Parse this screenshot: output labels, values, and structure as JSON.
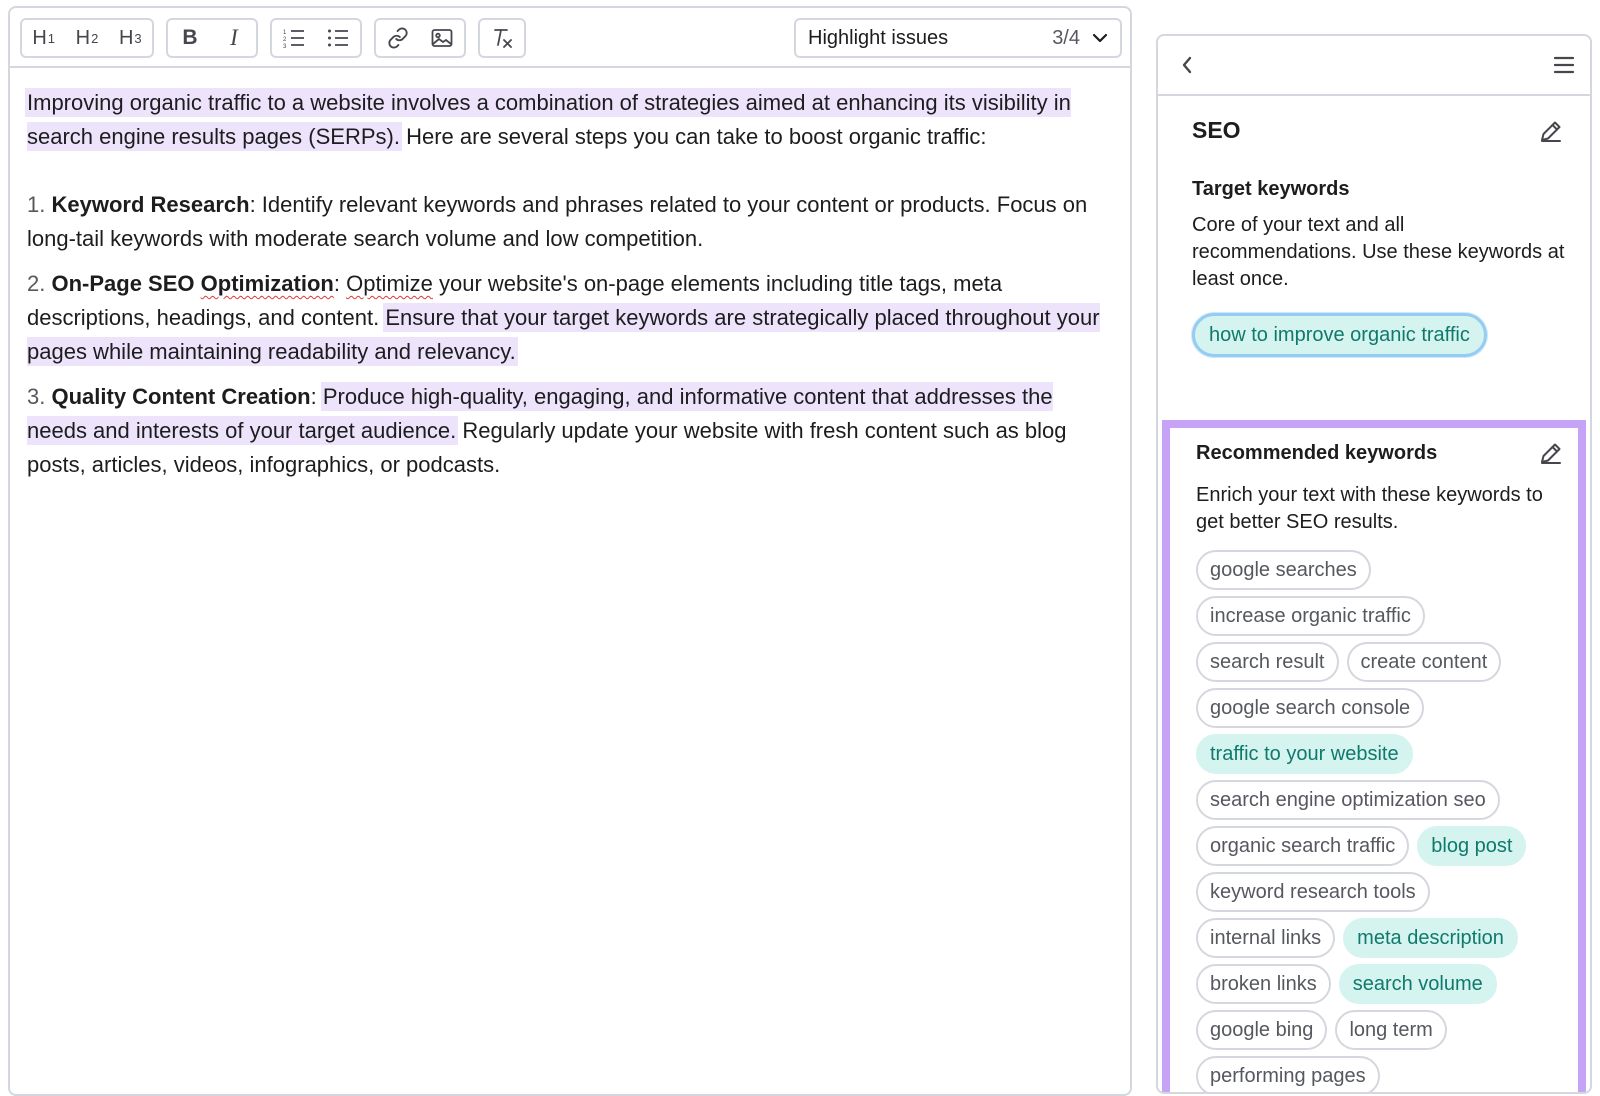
{
  "toolbar": {
    "h1": "H",
    "h1_sub": "1",
    "h2": "H",
    "h2_sub": "2",
    "h3": "H",
    "h3_sub": "3",
    "bold": "B",
    "italic": "I",
    "highlight_label": "Highlight issues",
    "highlight_count": "3/4"
  },
  "content": {
    "intro_hl": "Improving organic traffic to a website involves a combination of strategies aimed at enhancing its visibility in search engine results pages (SERPs).",
    "intro_rest": " Here are several steps you can take to boost organic traffic:",
    "items": [
      {
        "num": "1.",
        "title": "Keyword Research",
        "text": ": Identify relevant keywords and phrases related to your content or products. Focus on long-tail keywords with moderate search volume and low competition."
      },
      {
        "num": "2.",
        "title_a": "On-Page SEO ",
        "title_b": "Optimization",
        "colon": ": ",
        "spell_word": "Optimize",
        "text_plain": " your website's on-page elements including title tags, meta descriptions, headings, and content. ",
        "text_hl": "Ensure that your target keywords are strategically placed throughout your pages while maintaining readability and relevancy."
      },
      {
        "num": "3.",
        "title": "Quality Content Creation",
        "colon": ": ",
        "text_hl": "Produce high-quality, engaging, and informative content that addresses the needs and interests of your target audience.",
        "text_plain": " Regularly update your website with fresh content such as blog posts, articles, videos, infographics, or podcasts."
      }
    ]
  },
  "panel": {
    "seo_title": "SEO",
    "target_keywords_title": "Target keywords",
    "target_keywords_desc": "Core of your text and all recommendations. Use these keywords at least once.",
    "target_keyword": "how to improve organic traffic",
    "recommended_title": "Recommended keywords",
    "recommended_desc": "Enrich your text with these keywords to get better SEO results.",
    "recommended_rows": [
      [
        {
          "label": "google searches",
          "used": false
        }
      ],
      [
        {
          "label": "increase organic traffic",
          "used": false
        }
      ],
      [
        {
          "label": "search result",
          "used": false
        },
        {
          "label": "create content",
          "used": false
        }
      ],
      [
        {
          "label": "google search console",
          "used": false
        }
      ],
      [
        {
          "label": "traffic to your website",
          "used": true
        }
      ],
      [
        {
          "label": "search engine optimization seo",
          "used": false
        }
      ],
      [
        {
          "label": "organic search traffic",
          "used": false
        },
        {
          "label": "blog post",
          "used": true
        }
      ],
      [
        {
          "label": "keyword research tools",
          "used": false
        }
      ],
      [
        {
          "label": "internal links",
          "used": false
        },
        {
          "label": "meta description",
          "used": true
        }
      ],
      [
        {
          "label": "broken links",
          "used": false
        },
        {
          "label": "search volume",
          "used": true
        }
      ],
      [
        {
          "label": "google bing",
          "used": false
        },
        {
          "label": "long term",
          "used": false
        }
      ],
      [
        {
          "label": "performing pages",
          "used": false
        }
      ]
    ]
  },
  "colors": {
    "highlight": "#ede3fb",
    "used_keyword_bg": "#d5f3ef",
    "used_keyword_text": "#0f7a6c",
    "recommended_border": "#c6a3f6",
    "border": "#d4d7dd"
  }
}
